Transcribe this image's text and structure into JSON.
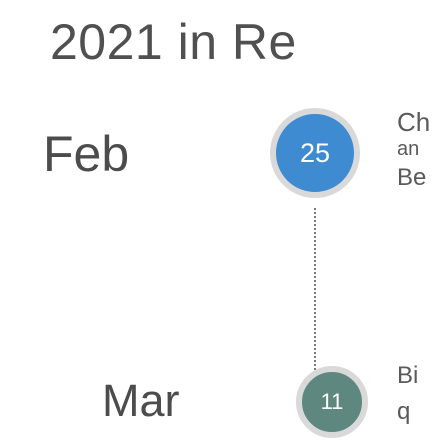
{
  "title": "2021 in Re",
  "entries": [
    {
      "month": "Feb",
      "day": "25",
      "lines": [
        "Ch",
        "an",
        "Be"
      ]
    },
    {
      "month": "Mar",
      "day": "11",
      "lines": [
        "Bi",
        "q"
      ]
    }
  ],
  "colors": {
    "feb_badge": "#3f8bd2",
    "mar_badge": "#5e877f",
    "badge_ring": "#d9d9d9"
  }
}
